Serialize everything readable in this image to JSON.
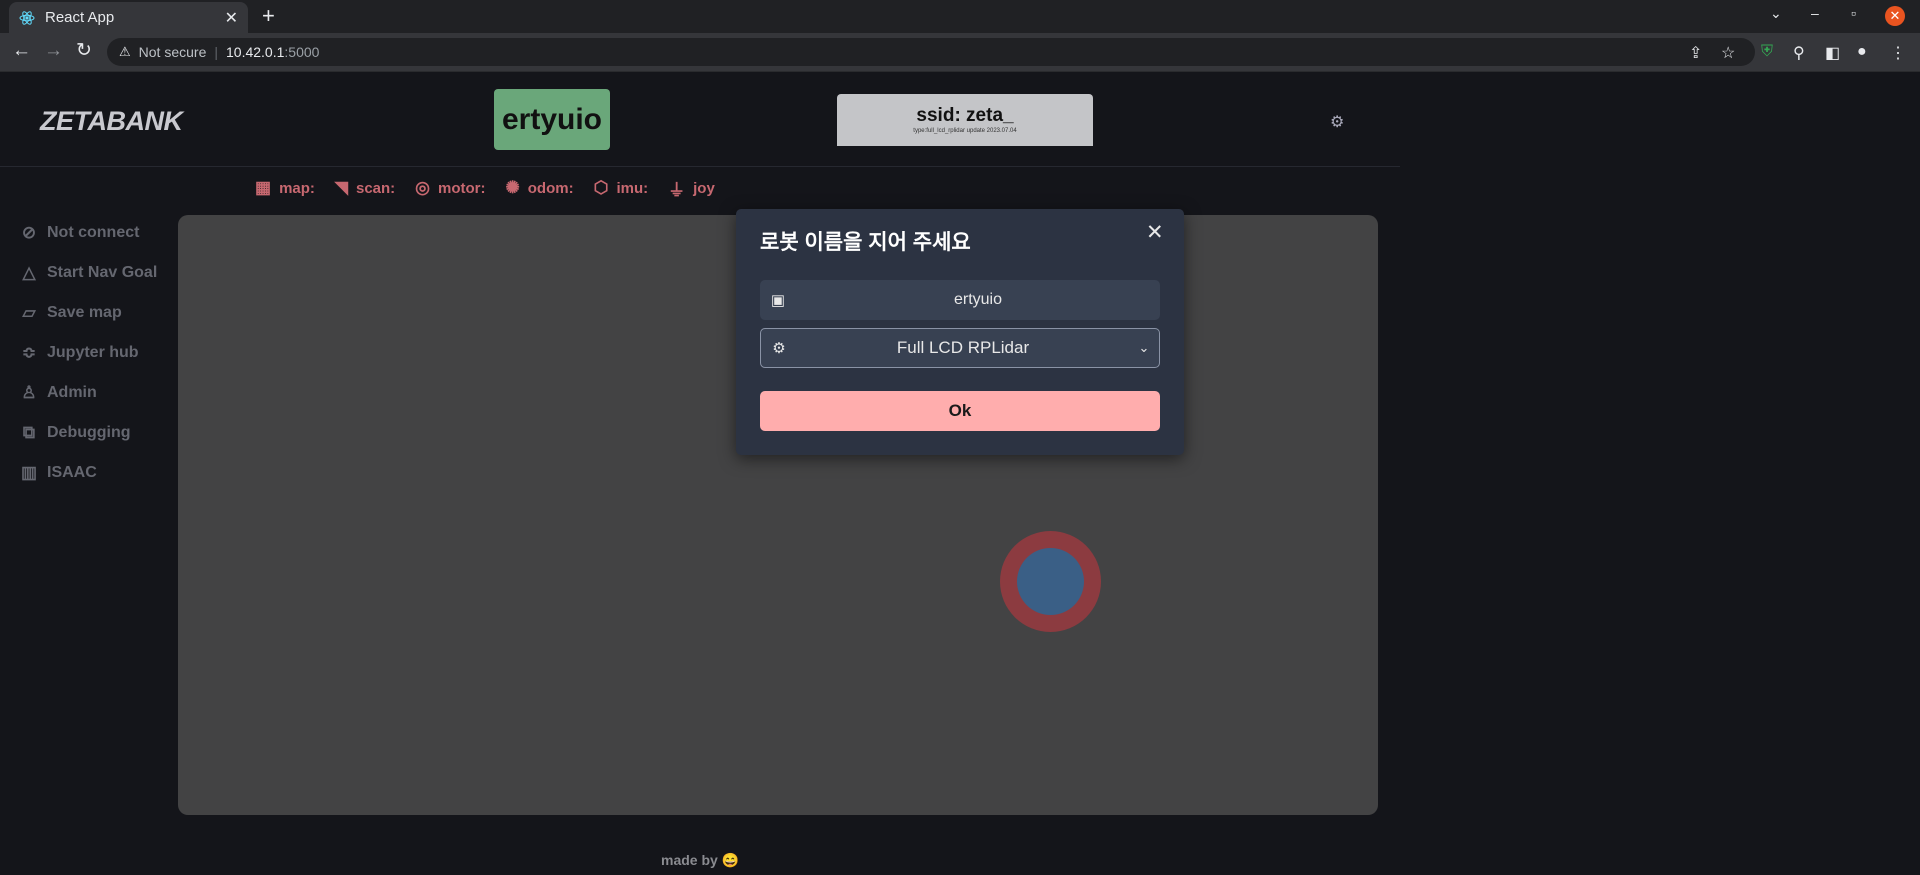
{
  "browser": {
    "tab_title": "React App",
    "tab_close": "✕",
    "new_tab": "+",
    "address_warning": "Not secure",
    "address_host": "10.42.0.1",
    "address_port": ":5000"
  },
  "header": {
    "logo": "ZETABANK",
    "robot_name": "ertyuio",
    "ssid_label": "ssid: zeta_",
    "ssid_sub": "type:full_lcd_rplidar update 2023.07.04"
  },
  "status": {
    "items": [
      {
        "label": "map:",
        "icon": "grid-icon"
      },
      {
        "label": "scan:",
        "icon": "wifi-icon"
      },
      {
        "label": "motor:",
        "icon": "motor-icon"
      },
      {
        "label": "odom:",
        "icon": "gear-icon"
      },
      {
        "label": "imu:",
        "icon": "cube-icon"
      },
      {
        "label": "joy",
        "icon": "joystick-icon"
      }
    ]
  },
  "sidebar": {
    "items": [
      {
        "label": "Not connect",
        "icon": "compass-icon"
      },
      {
        "label": "Start Nav Goal",
        "icon": "navigation-icon"
      },
      {
        "label": "Save map",
        "icon": "map-icon"
      },
      {
        "label": "Jupyter hub",
        "icon": "jupyter-icon"
      },
      {
        "label": "Admin",
        "icon": "user-icon"
      },
      {
        "label": "Debugging",
        "icon": "debug-icon"
      },
      {
        "label": "ISAAC",
        "icon": "chart-icon"
      }
    ]
  },
  "footer": {
    "text": "made by 😄"
  },
  "modal": {
    "title": "로봇 이름을 지어 주세요",
    "close": "✕",
    "name_value": "ertyuio",
    "select_value": "Full LCD RPLidar",
    "ok_label": "Ok"
  }
}
